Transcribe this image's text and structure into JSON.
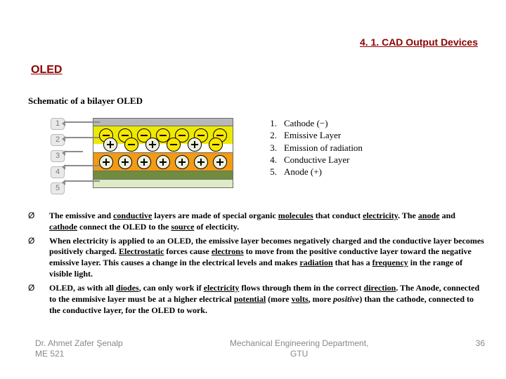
{
  "breadcrumb": "4. 1. CAD Output Devices",
  "title": "OLED",
  "subtitle": "Schematic of a bilayer OLED",
  "diagram": {
    "numbers": [
      "1",
      "2",
      "3",
      "4",
      "5"
    ]
  },
  "legend": [
    {
      "num": "1.",
      "text": "Cathode (−)"
    },
    {
      "num": "2.",
      "text": "Emissive Layer"
    },
    {
      "num": "3.",
      "text": "Emission of radiation"
    },
    {
      "num": "4.",
      "text": "Conductive Layer"
    },
    {
      "num": "5.",
      "text": "Anode (+)"
    }
  ],
  "bullets": [
    {
      "html": "<b>The emissive and <span class='u'>conductive</span> layers are made of special organic <span class='u'>molecules</span> that conduct <span class='u'>electricity</span>. The <span class='u'>anode</span> and <span class='u'>cathode</span> connect the OLED to the <span class='u'>source</span> of electicity.</b>"
    },
    {
      "html": "<b>When electricity is applied to an OLED, the emissive layer becomes negatively charged and the conductive layer becomes positively charged. <span class='u'>Electrostatic</span> forces cause <span class='u'>electrons</span> to move from the positive conductive layer toward the negative emissive layer. This causes a change in the electrical levels and makes <span class='u'>radiation</span> that has a <span class='u'>frequency</span> in the range of visible light.</b>"
    },
    {
      "html": "<b>OLED, as with all <span class='u'>diodes</span>, can only work if <span class='u'>electricity</span> flows through them in the correct <span class='u'>direction</span>. The Anode, connected to the emmisive layer must be at a higher electrical <span class='u'>potential</span> (more <span class='u'>volts</span>, more <i>positive</i>) than the cathode, connected to the conductive layer, for the OLED to work.</b>"
    }
  ],
  "footer": {
    "left": "Dr. Ahmet Zafer Şenalp\nME 521",
    "center": "Mechanical Engineering Department,\nGTU",
    "page": "36"
  }
}
